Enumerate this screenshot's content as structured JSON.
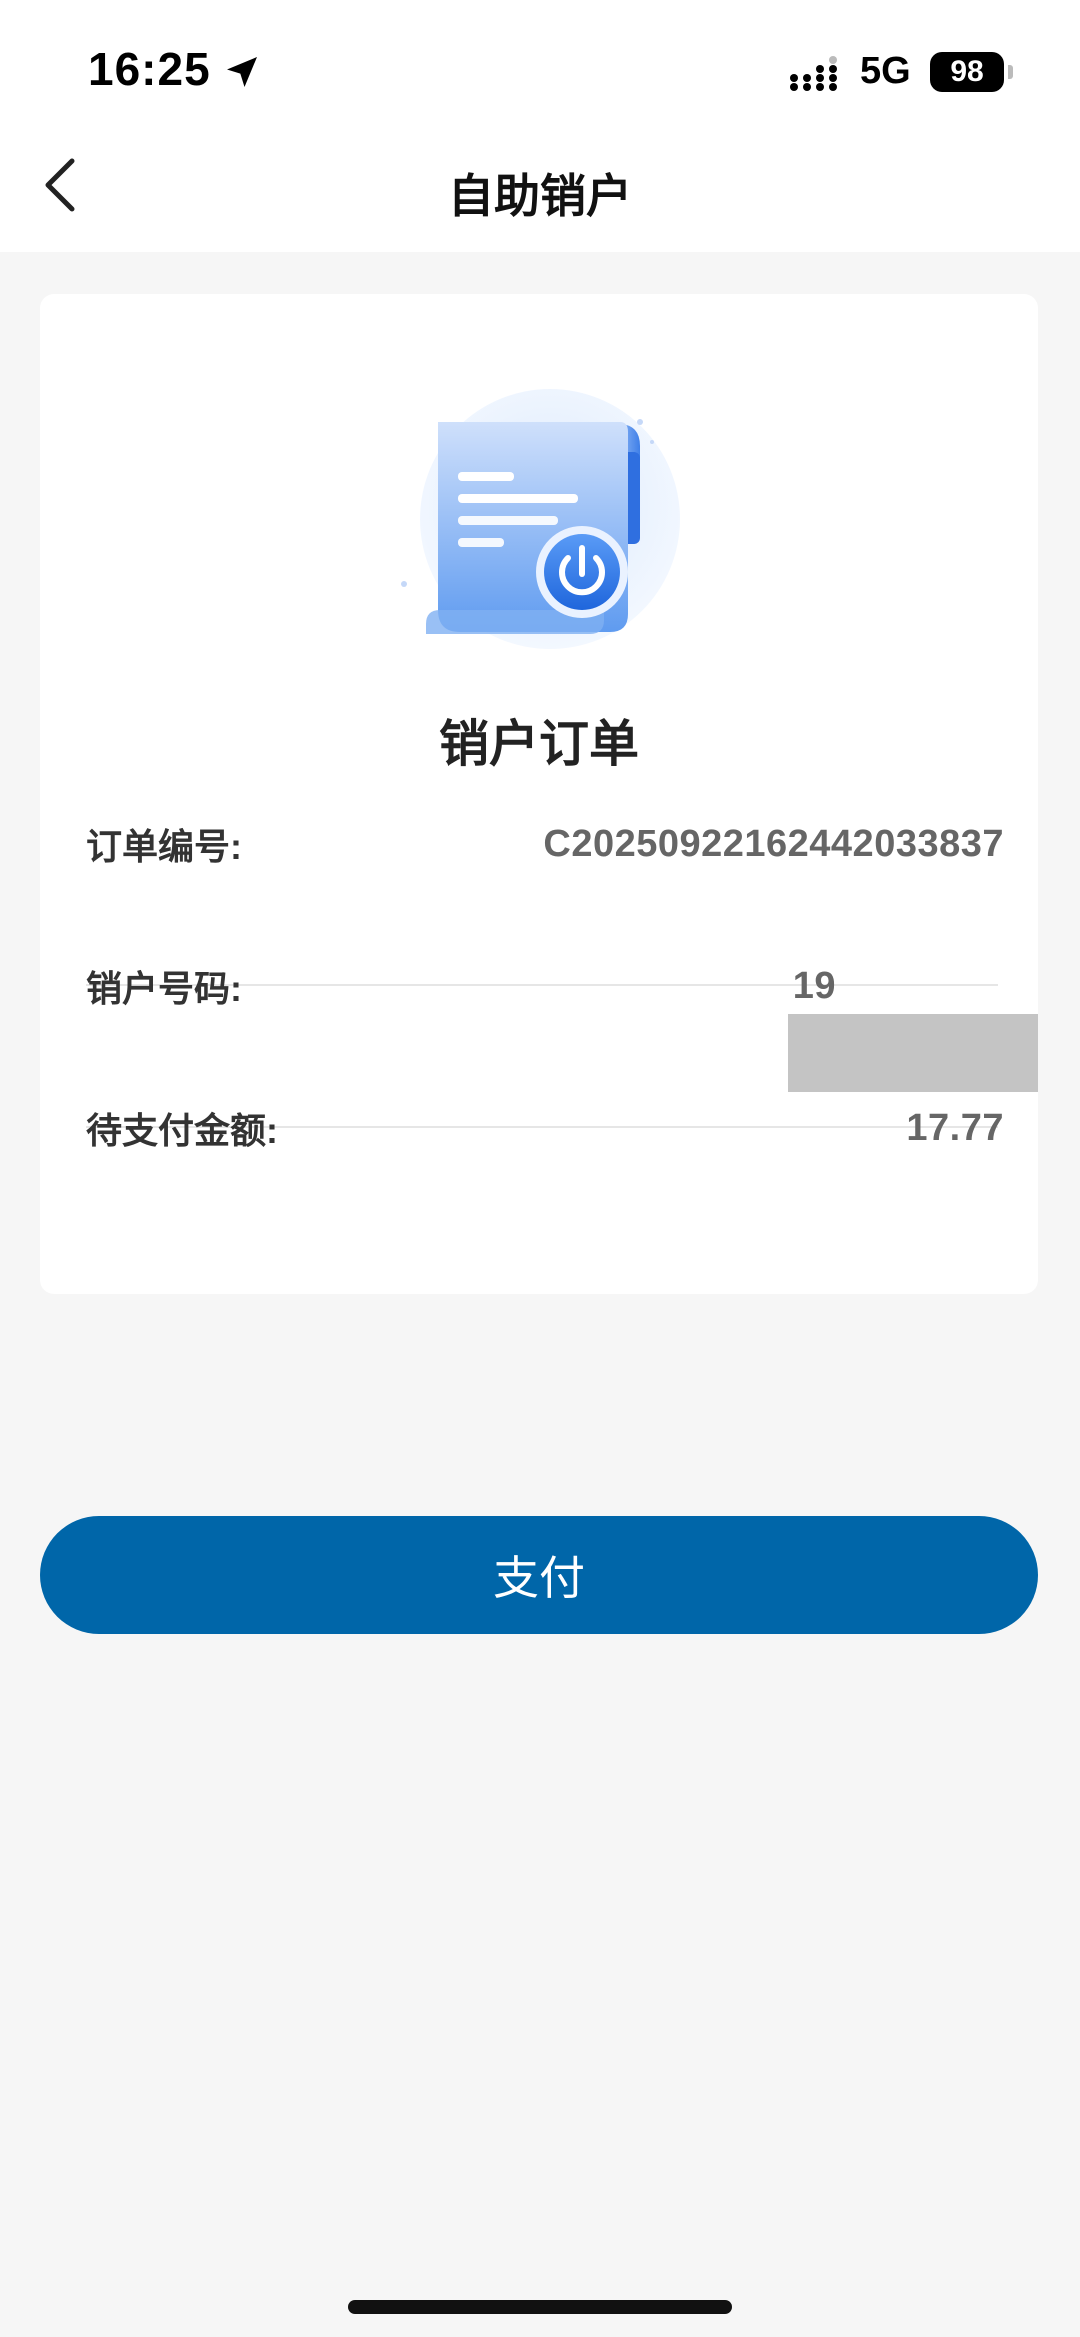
{
  "status_bar": {
    "time": "16:25",
    "network": "5G",
    "battery": "98",
    "icons": [
      "location-arrow-icon",
      "signal-icon"
    ]
  },
  "nav": {
    "title": "自助销户",
    "back_icon": "chevron-left-icon"
  },
  "order": {
    "title": "销户订单",
    "illustration": "document-power-icon",
    "rows": [
      {
        "label": "订单编号:",
        "value": "C20250922162442033837"
      },
      {
        "label": "销户号码:",
        "value": "19"
      },
      {
        "label": "待支付金额:",
        "value": "17.77"
      }
    ]
  },
  "pay_button": {
    "label": "支付"
  },
  "colors": {
    "primary": "#0066a9",
    "background": "#f6f6f6",
    "card": "#ffffff",
    "illustration_blue": "#4a8df0"
  }
}
